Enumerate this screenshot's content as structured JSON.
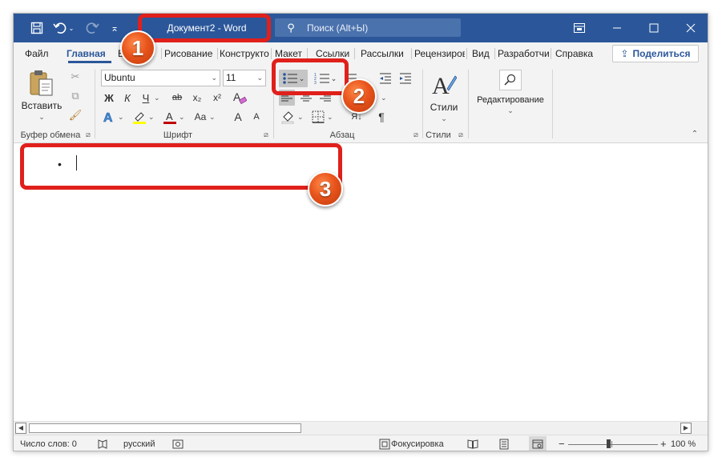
{
  "colors": {
    "title_bar": "#2b579a",
    "annotation": "#e0201b",
    "badge": "#e8541c",
    "font_color": "#c00000",
    "highlight_color": "#ffff00"
  },
  "titlebar": {
    "document_title": "Документ2  -  Word",
    "search_placeholder": "Поиск (Alt+Ы)",
    "qat_icons": [
      "save-icon",
      "undo-icon",
      "redo-icon",
      "customize-qat-icon"
    ],
    "window_icons": [
      "ribbon-display-options-icon",
      "minimize-icon",
      "maximize-icon",
      "close-icon"
    ]
  },
  "tabs": [
    {
      "label": "Файл"
    },
    {
      "label": "Главная"
    },
    {
      "label": "Вставка"
    },
    {
      "label": "Рисование"
    },
    {
      "label": "Конструктор"
    },
    {
      "label": "Макет"
    },
    {
      "label": "Ссылки"
    },
    {
      "label": "Рассылки"
    },
    {
      "label": "Рецензирование"
    },
    {
      "label": "Вид"
    },
    {
      "label": "Разработчик"
    },
    {
      "label": "Справка"
    }
  ],
  "share_label": "Поделиться",
  "ribbon": {
    "clipboard": {
      "label": "Буфер обмена",
      "paste_label": "Вставить"
    },
    "font": {
      "label": "Шрифт",
      "font_name": "Ubuntu",
      "font_size": "11",
      "bold": "Ж",
      "italic": "К",
      "underline": "Ч",
      "strike": "ab",
      "subscript": "x₂",
      "superscript": "x²",
      "font_color_letter": "A",
      "change_case": "Aa",
      "grow": "A",
      "shrink": "A"
    },
    "paragraph": {
      "label": "Абзац",
      "sort_label": "Я↓",
      "marks": "¶"
    },
    "styles": {
      "label": "Стили",
      "button_label": "Стили"
    },
    "editing": {
      "label": "Редактирование"
    }
  },
  "document": {
    "bullet": "•"
  },
  "statusbar": {
    "word_count": "Число слов: 0",
    "language": "русский",
    "focus": "Фокусировка",
    "zoom": "100 %",
    "zoom_minus": "−",
    "zoom_plus": "+"
  },
  "annotations": [
    {
      "number": "1",
      "target": "document-title"
    },
    {
      "number": "2",
      "target": "bullets-button"
    },
    {
      "number": "3",
      "target": "bulleted-line"
    }
  ]
}
